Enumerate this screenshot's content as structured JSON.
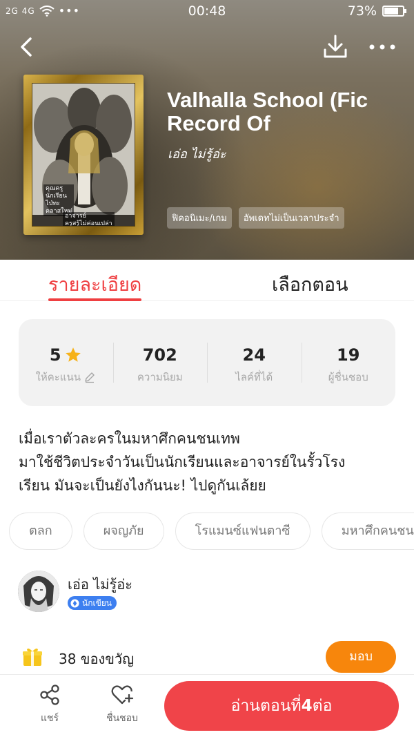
{
  "status_bar": {
    "signal_text": "2G 4G",
    "time": "00:48",
    "battery": "73%"
  },
  "header": {
    "title_line1": "Valhalla School (Fic",
    "title_line2": "Record Of",
    "author": "เอ่อ ไม่รู้อ่ะ",
    "genres": [
      "ฟิคอนิเมะ/เกม",
      "อัพเดทไม่เป็นเวลาประจำ"
    ],
    "cover_text_1": "คุณครู\nนักเรียน\nไป่ทะ\nคลาสใหม่",
    "cover_text_2": "อาจารย์\nครูสรู้ไม่ค่อนเปล่า"
  },
  "tabs": {
    "details": "รายละเอียด",
    "episodes": "เลือกตอน"
  },
  "stats": [
    {
      "value": "5",
      "label": "ให้คะแนน",
      "icon": "star-icon"
    },
    {
      "value": "702",
      "label": "ความนิยม"
    },
    {
      "value": "24",
      "label": "ไลค์ที่ได้"
    },
    {
      "value": "19",
      "label": "ผู้ชื่นชอบ"
    }
  ],
  "description": {
    "line1": "เมื่อเราตัวละครในมหาศึกคนชนเทพ",
    "line2": "มาใช้ชีวิตประจำวันเป็นนักเรียนและอาจารย์ในรั้วโรง",
    "line3": "เรียน มันจะเป็นยังไงกันนะ! ไปดูกันเล้ยย"
  },
  "tags": [
    "ตลก",
    "ผจญภัย",
    "โรแมนซ์แฟนตาซี",
    "มหาศึกคนชนเทพ"
  ],
  "author": {
    "name": "เอ่อ ไม่รู้อ่ะ",
    "badge": "นักเขียน"
  },
  "gifts": {
    "count_text": "38 ของขวัญ",
    "give_label": "มอบ"
  },
  "bottom_bar": {
    "share": "แชร์",
    "favorite": "ชื่นชอบ",
    "read_prefix": "อ่านตอนที่",
    "read_episode": "4",
    "read_suffix": "ต่อ"
  },
  "colors": {
    "accent": "#ef3f41",
    "gift_button": "#f7860c",
    "badge": "#3d7ff0",
    "star": "#f6b21a"
  }
}
